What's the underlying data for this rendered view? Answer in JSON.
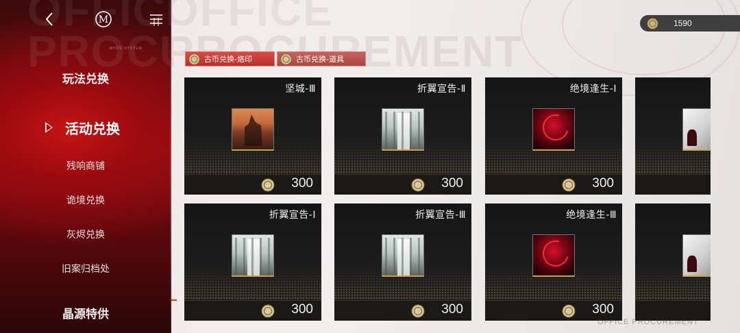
{
  "background": {
    "watermark_lines": [
      "OFFICE",
      "PROCUREMENT"
    ],
    "small_tag": "MHCE SYSTEM",
    "footer_mark": "OFFICE PROCUREMENT"
  },
  "header": {
    "back_icon": "chevron-left-icon",
    "logo_letter": "M",
    "menu_icon": "menu-icon"
  },
  "sidebar": {
    "items": [
      {
        "label": "玩法兑换",
        "type": "header"
      },
      {
        "label": "活动兑换",
        "type": "active"
      },
      {
        "label": "残响商铺",
        "type": "sub"
      },
      {
        "label": "诡境兑换",
        "type": "sub"
      },
      {
        "label": "灰烬兑换",
        "type": "sub"
      },
      {
        "label": "旧案归档处",
        "type": "sub"
      },
      {
        "label": "晶源特供",
        "type": "header"
      }
    ]
  },
  "currency": {
    "icon": "coin-icon",
    "amount": "1590"
  },
  "tabs": [
    {
      "label": "古币兑换-烙印",
      "selected": true
    },
    {
      "label": "古币兑换-道具",
      "selected": false
    }
  ],
  "cards": [
    {
      "title": "坚城-Ⅲ",
      "price": "300",
      "art": "city"
    },
    {
      "title": "折翼宣告-Ⅱ",
      "price": "300",
      "art": "hall"
    },
    {
      "title": "绝境逢生-Ⅰ",
      "price": "300",
      "art": "red"
    },
    {
      "title": "",
      "price": "",
      "art": "white"
    },
    {
      "title": "折翼宣告-Ⅰ",
      "price": "300",
      "art": "hall"
    },
    {
      "title": "折翼宣告-Ⅲ",
      "price": "300",
      "art": "hall"
    },
    {
      "title": "绝境逢生-Ⅲ",
      "price": "300",
      "art": "red"
    },
    {
      "title": "",
      "price": "",
      "art": "white"
    }
  ],
  "colors": {
    "accent_red": "#b8302c",
    "sidebar_red": "#8e1014",
    "card_bg": "#1d1d1d",
    "gold": "#c9a34c"
  }
}
